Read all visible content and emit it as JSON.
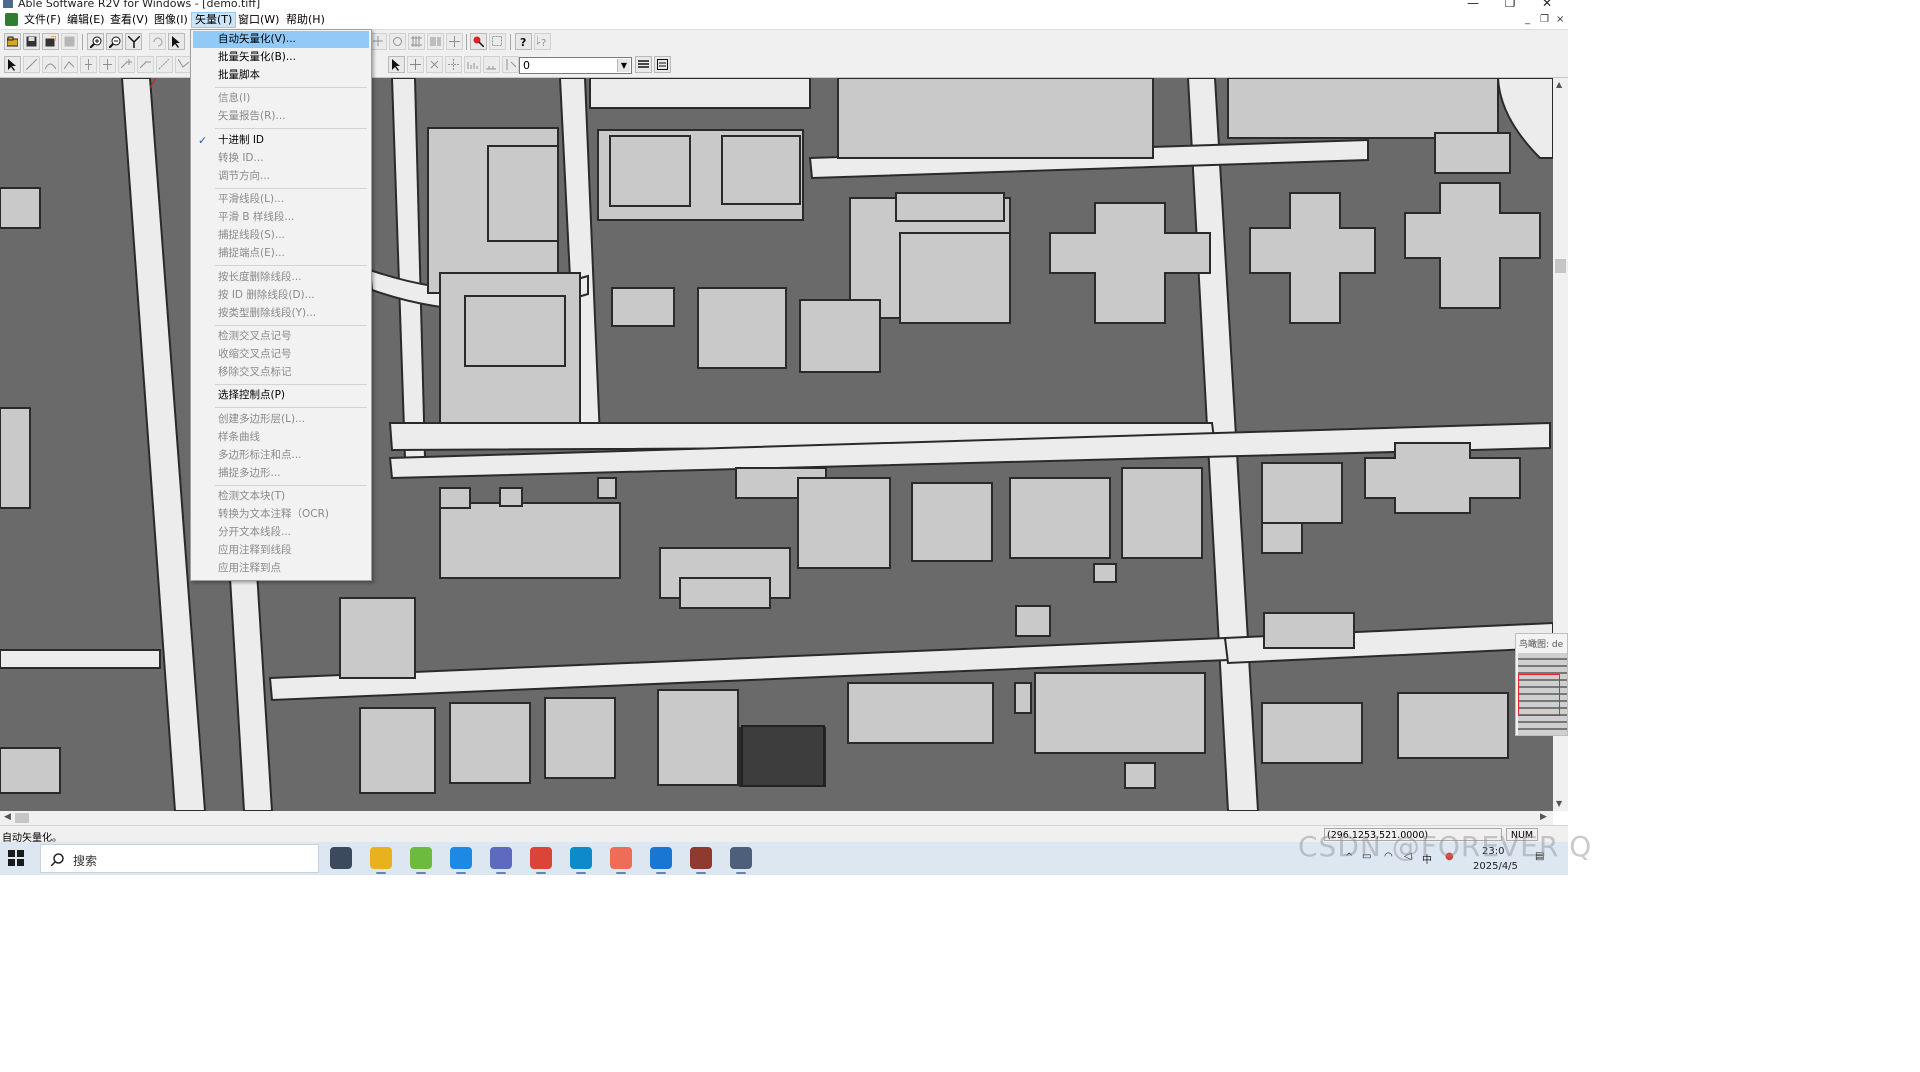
{
  "window": {
    "title": "Able Software R2V for Windows - [demo.tiff]",
    "minimize_glyph": "—",
    "restore_glyph": "❐",
    "close_glyph": "✕",
    "mdi_minimize_glyph": "_",
    "mdi_restore_glyph": "❐",
    "mdi_close_glyph": "×"
  },
  "menubar": {
    "items": [
      {
        "label": "文件(F)"
      },
      {
        "label": "编辑(E)"
      },
      {
        "label": "查看(V)"
      },
      {
        "label": "图像(I)"
      },
      {
        "label": "矢量(T)",
        "active": true
      },
      {
        "label": "窗口(W)"
      },
      {
        "label": "帮助(H)"
      }
    ]
  },
  "toolbar": {
    "layer_combo_value": "0"
  },
  "vector_menu": {
    "items": [
      {
        "label": "自动矢量化(V)...",
        "state": "highlighted"
      },
      {
        "label": "批量矢量化(B)...",
        "state": "enabled"
      },
      {
        "label": "批量脚本",
        "state": "enabled"
      },
      {
        "label": "信息(I)",
        "state": "disabled"
      },
      {
        "label": "矢量报告(R)...",
        "state": "disabled"
      },
      {
        "label": "十进制 ID",
        "state": "checked"
      },
      {
        "label": "转换 ID...",
        "state": "disabled"
      },
      {
        "label": "调节方向...",
        "state": "disabled"
      },
      {
        "label": "平滑线段(L)...",
        "state": "disabled"
      },
      {
        "label": "平滑 B 样线段...",
        "state": "disabled"
      },
      {
        "label": "捕捉线段(S)...",
        "state": "disabled"
      },
      {
        "label": "捕捉端点(E)...",
        "state": "disabled"
      },
      {
        "label": "按长度删除线段...",
        "state": "disabled"
      },
      {
        "label": "按 ID 删除线段(D)...",
        "state": "disabled"
      },
      {
        "label": "按类型删除线段(Y)...",
        "state": "disabled"
      },
      {
        "label": "检测交叉点记号",
        "state": "disabled"
      },
      {
        "label": "收缩交叉点记号",
        "state": "disabled"
      },
      {
        "label": "移除交叉点标记",
        "state": "disabled"
      },
      {
        "label": "选择控制点(P)",
        "state": "enabled"
      },
      {
        "label": "创建多边形层(L)...",
        "state": "disabled"
      },
      {
        "label": "样条曲线",
        "state": "disabled"
      },
      {
        "label": "多边形标注和点...",
        "state": "disabled"
      },
      {
        "label": "捕捉多边形...",
        "state": "disabled"
      },
      {
        "label": "检测文本块(T)",
        "state": "disabled"
      },
      {
        "label": "转换为文本注释（OCR)",
        "state": "disabled"
      },
      {
        "label": "分开文本线段...",
        "state": "disabled"
      },
      {
        "label": "应用注释到线段",
        "state": "disabled"
      },
      {
        "label": "应用注释到点",
        "state": "disabled"
      }
    ],
    "separators_after": [
      2,
      4,
      7,
      11,
      14,
      17,
      18,
      22
    ],
    "check_glyph": "✓"
  },
  "overview": {
    "title": "鸟瞰图: de"
  },
  "statusbar": {
    "message": "自动矢量化。",
    "coordinates": "(296.1253,521.0000)",
    "num_indicator": "NUM"
  },
  "taskbar": {
    "search_placeholder": "搜索",
    "clock_time": "23:0",
    "clock_date": "2025/4/5",
    "apps": [
      {
        "name": "task-view",
        "color": "#3b4a5c"
      },
      {
        "name": "file-explorer",
        "color": "#e8b21e"
      },
      {
        "name": "qgis",
        "color": "#6dbb3c"
      },
      {
        "name": "app-blue",
        "color": "#1e88e5"
      },
      {
        "name": "app-purple",
        "color": "#5c6bc0"
      },
      {
        "name": "chrome",
        "color": "#db4437"
      },
      {
        "name": "edge",
        "color": "#0c8ac9"
      },
      {
        "name": "app-red",
        "color": "#ef6c57"
      },
      {
        "name": "app-lightning",
        "color": "#1976d2"
      },
      {
        "name": "winrar",
        "color": "#8e3b2e"
      },
      {
        "name": "r2v",
        "color": "#4d5f7a"
      }
    ]
  },
  "watermark": "CSDN @FOREVER Q"
}
